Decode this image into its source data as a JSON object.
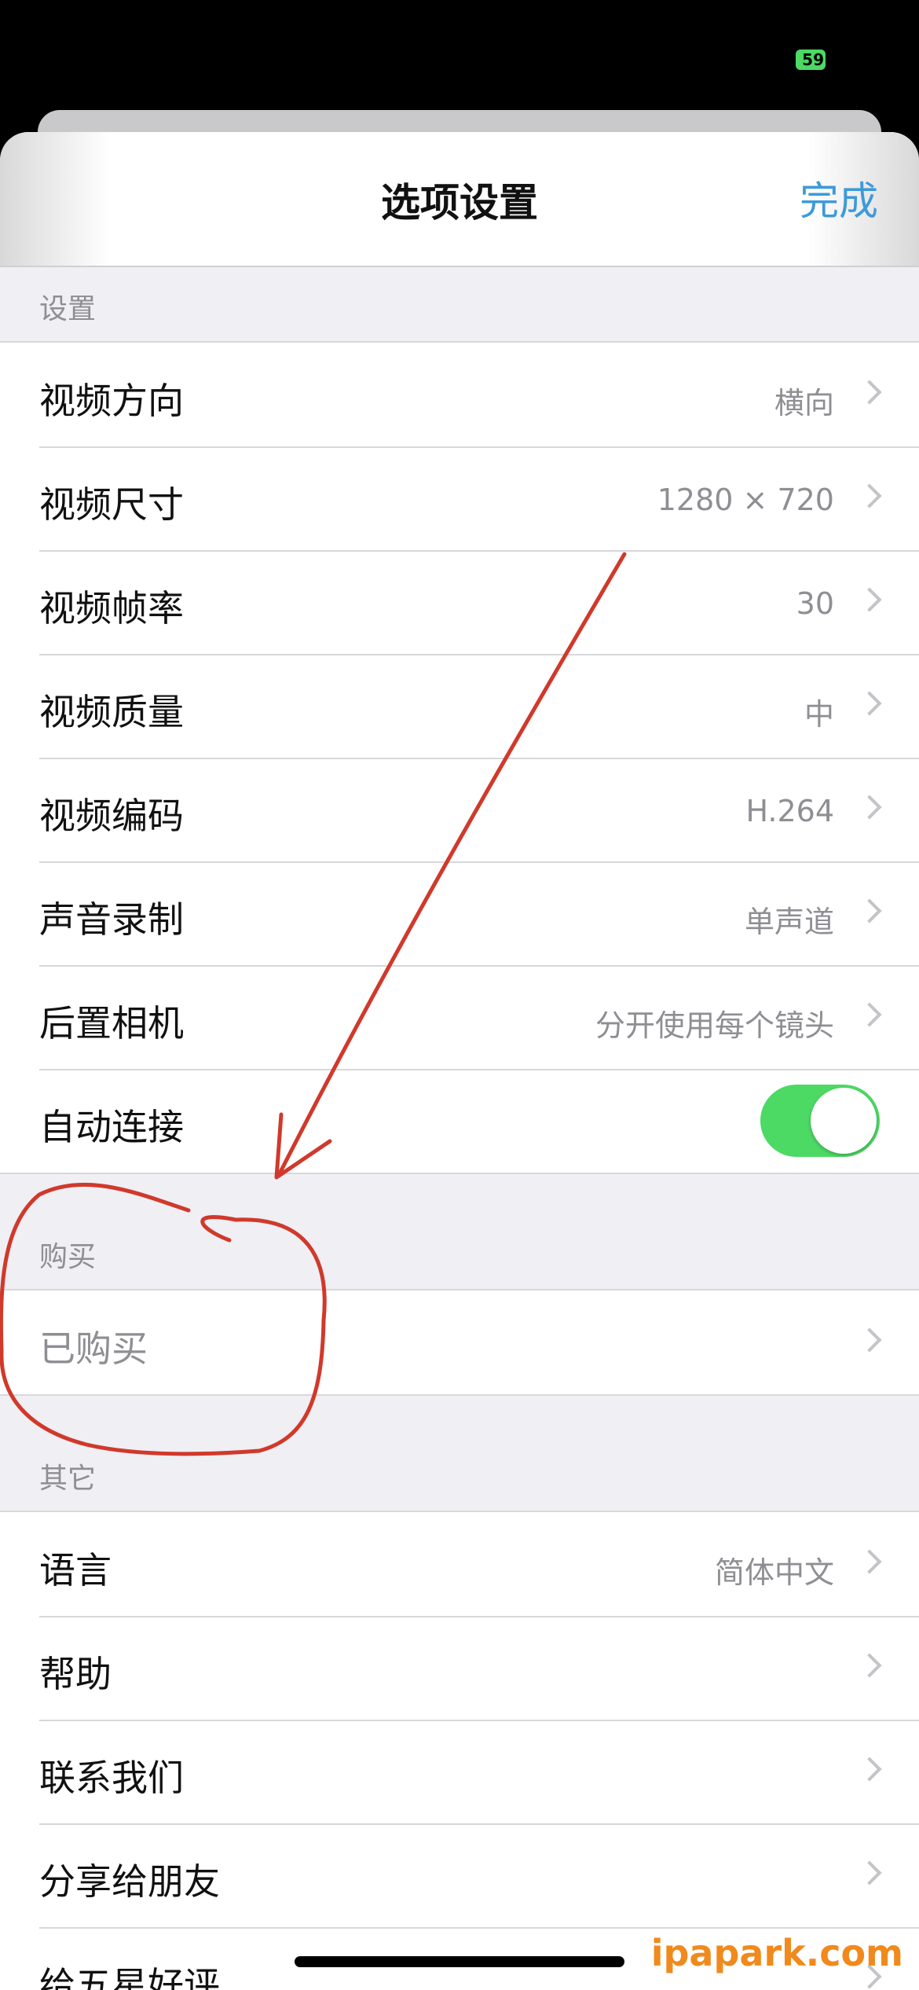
{
  "status_bar": {
    "battery": "59"
  },
  "nav": {
    "title": "选项设置",
    "done_label": "完成"
  },
  "sections": [
    {
      "header": "设置",
      "rows": [
        {
          "label": "视频方向",
          "value": "横向"
        },
        {
          "label": "视频尺寸",
          "value": "1280 × 720"
        },
        {
          "label": "视频帧率",
          "value": "30"
        },
        {
          "label": "视频质量",
          "value": "中"
        },
        {
          "label": "视频编码",
          "value": "H.264"
        },
        {
          "label": "声音录制",
          "value": "单声道"
        },
        {
          "label": "后置相机",
          "value": "分开使用每个镜头"
        },
        {
          "label": "自动连接",
          "toggle": true
        }
      ]
    },
    {
      "header": "购买",
      "rows": [
        {
          "label": "已购买",
          "value": ""
        }
      ]
    },
    {
      "header": "其它",
      "rows": [
        {
          "label": "语言",
          "value": "简体中文"
        },
        {
          "label": "帮助",
          "value": ""
        },
        {
          "label": "联系我们",
          "value": ""
        },
        {
          "label": "分享给朋友",
          "value": ""
        },
        {
          "label": "给五星好评",
          "value": ""
        }
      ]
    }
  ],
  "annotation_color": "#d0392b",
  "accent_color": "#3d9ad9",
  "toggle_color": "#4cd964",
  "watermark": "ipapark.com"
}
